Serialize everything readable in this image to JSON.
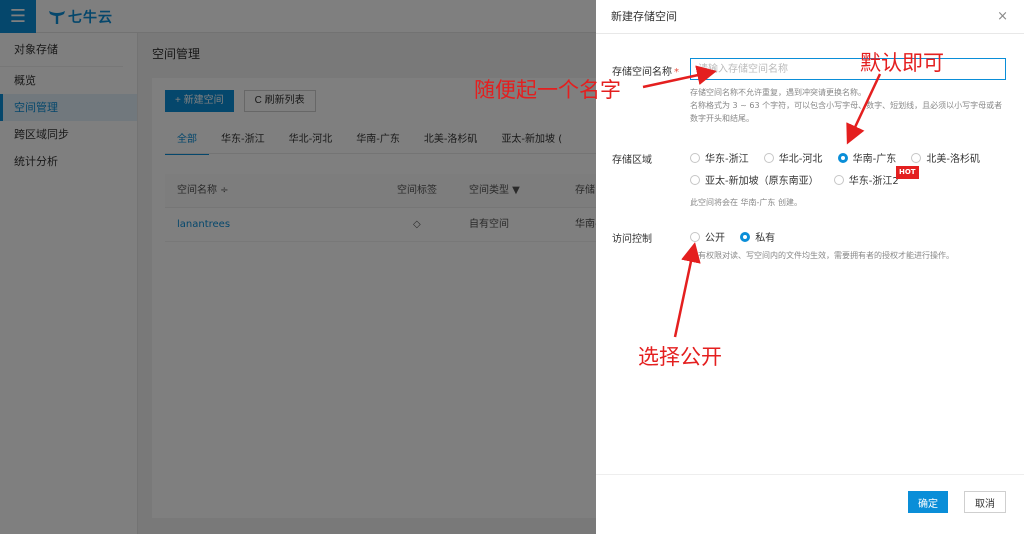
{
  "app": {
    "menu_icon": "☰",
    "logo_text": "七牛云"
  },
  "sidebar": {
    "head": "对象存储",
    "items": [
      {
        "label": "概览"
      },
      {
        "label": "空间管理"
      },
      {
        "label": "跨区域同步"
      },
      {
        "label": "统计分析"
      }
    ]
  },
  "main": {
    "title": "空间管理",
    "new_button": "+  新建空间",
    "refresh_button": "C  刷新列表",
    "tabs": [
      {
        "label": "全部"
      },
      {
        "label": "华东-浙江"
      },
      {
        "label": "华北-河北"
      },
      {
        "label": "华南-广东"
      },
      {
        "label": "北美-洛杉矶"
      },
      {
        "label": "亚太-新加坡 ("
      }
    ],
    "table": {
      "headers": [
        "空间名称 ÷",
        "空间标签",
        "空间类型  ▼",
        "存储"
      ],
      "rows": [
        {
          "name": "lanantrees",
          "tag_icon": "◇",
          "type": "自有空间",
          "region": "华南-"
        }
      ]
    }
  },
  "drawer": {
    "title": "新建存储空间",
    "close": "×",
    "name_label": "存储空间名称",
    "required_mark": "*",
    "name_placeholder": "请输入存储空间名称",
    "name_help_1": "存储空间名称不允许重复，遇到冲突请更换名称。",
    "name_help_2": "名称格式为 3 ~ 63 个字符，可以包含小写字母、数字、短划线，且必须以小写字母或者数字开头和结尾。",
    "region_label": "存储区域",
    "regions": [
      {
        "label": "华东-浙江",
        "checked": false
      },
      {
        "label": "华北-河北",
        "checked": false
      },
      {
        "label": "华南-广东",
        "checked": true
      },
      {
        "label": "北美-洛杉矶",
        "checked": false
      },
      {
        "label": "亚太-新加坡（原东南亚）",
        "checked": false
      },
      {
        "label": "华东-浙江2",
        "checked": false
      }
    ],
    "hot_badge": "HOT",
    "region_help": "此空间将会在 华南-广东 创建。",
    "access_label": "访问控制",
    "access_options": [
      {
        "label": "公开",
        "checked": false
      },
      {
        "label": "私有",
        "checked": true
      }
    ],
    "access_help": "私有权限对读、写空间内的文件均生效，需要拥有者的授权才能进行操作。",
    "ok_button": "确定",
    "cancel_button": "取消"
  },
  "annotations": {
    "name_hint": "随便起一个名字",
    "region_hint": "默认即可",
    "access_hint": "选择公开"
  }
}
